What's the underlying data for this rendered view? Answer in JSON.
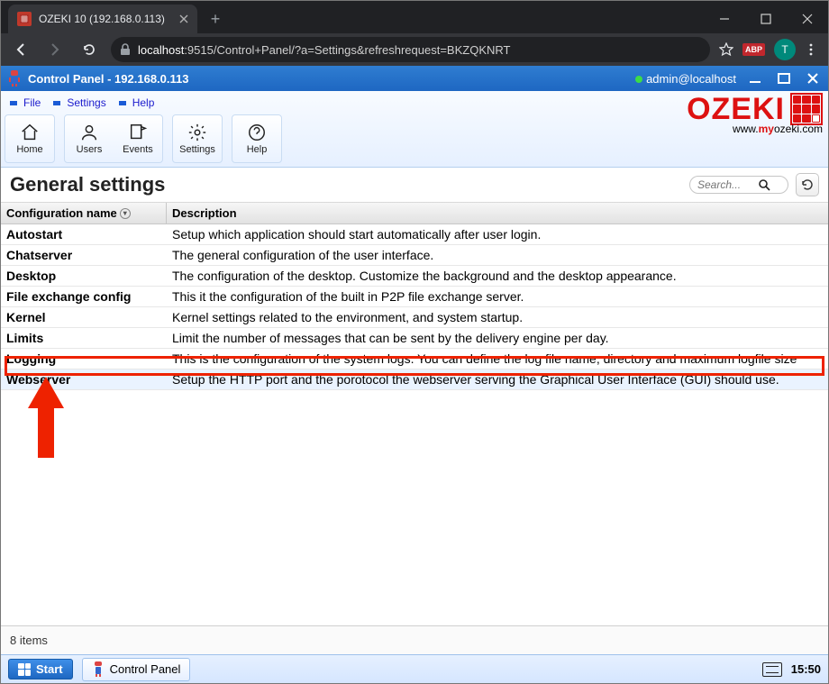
{
  "browser": {
    "tab_title": "OZEKI 10 (192.168.0.113)",
    "url_host": "localhost",
    "url_path": ":9515/Control+Panel/?a=Settings&refreshrequest=BKZQKNRT",
    "avatar_letter": "T",
    "abp_label": "ABP"
  },
  "appbar": {
    "title": "Control Panel - 192.168.0.113",
    "user": "admin@localhost"
  },
  "menu": {
    "file": "File",
    "settings": "Settings",
    "help": "Help"
  },
  "toolbar": {
    "home": "Home",
    "users": "Users",
    "events": "Events",
    "settings": "Settings",
    "help": "Help"
  },
  "logo": {
    "brand": "OZEKI",
    "url_pre": "www.",
    "url_mid": "my",
    "url_post": "ozeki.com"
  },
  "page": {
    "title": "General settings",
    "search_placeholder": "Search...",
    "columns": {
      "name": "Configuration name",
      "desc": "Description"
    },
    "rows": [
      {
        "name": "Autostart",
        "desc": "Setup which application should start automatically after user login."
      },
      {
        "name": "Chatserver",
        "desc": "The general configuration of the user interface."
      },
      {
        "name": "Desktop",
        "desc": "The configuration of the desktop. Customize the background and the desktop appearance."
      },
      {
        "name": "File exchange config",
        "desc": "This it the configuration of the built in P2P file exchange server."
      },
      {
        "name": "Kernel",
        "desc": "Kernel settings related to the environment, and system startup."
      },
      {
        "name": "Limits",
        "desc": "Limit the number of messages that can be sent by the delivery engine per day."
      },
      {
        "name": "Logging",
        "desc": "This is the configuration of the system logs. You can define the log file name, directory and maximum logfile size"
      },
      {
        "name": "Webserver",
        "desc": "Setup the HTTP port and the porotocol the webserver serving the Graphical User Interface (GUI) should use."
      }
    ],
    "footer": "8 items"
  },
  "taskbar": {
    "start": "Start",
    "app": "Control Panel",
    "clock": "15:50"
  }
}
